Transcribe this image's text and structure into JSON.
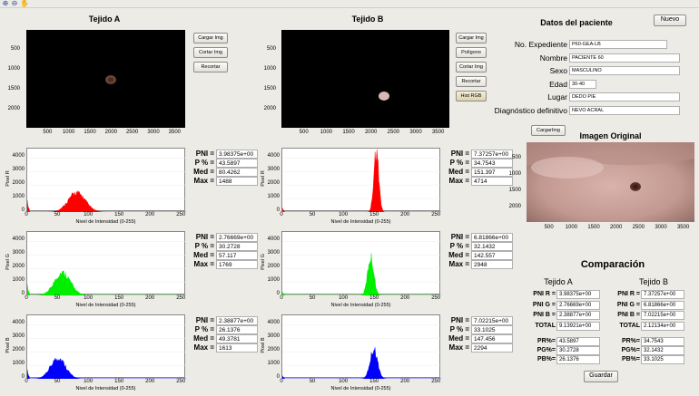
{
  "toolbar": {
    "icons": [
      "zoom-in-icon",
      "zoom-out-icon",
      "pan-icon"
    ]
  },
  "tejido_a": {
    "title": "Tejido A",
    "x_ticks": [
      "500",
      "1000",
      "1500",
      "2000",
      "2500",
      "3000",
      "3500"
    ],
    "y_ticks": [
      "500",
      "1000",
      "1500",
      "2000"
    ],
    "buttons": [
      "Cargar Img",
      "Cortar Img",
      "Recortar"
    ]
  },
  "tejido_b": {
    "title": "Tejido B",
    "x_ticks": [
      "500",
      "1000",
      "1500",
      "2000",
      "2500",
      "3000",
      "3500"
    ],
    "y_ticks": [
      "500",
      "1000",
      "1500",
      "2000"
    ],
    "buttons": [
      "Cargar Img",
      "Polígono",
      "Cortar Img",
      "Recortar",
      "Hist RGB"
    ]
  },
  "histogram_axes": {
    "x_ticks": [
      "0",
      "50",
      "100",
      "150",
      "200",
      "250"
    ],
    "y_ticks": [
      "0",
      "1000",
      "2000",
      "3000",
      "4000"
    ],
    "xlabel": "Nivel de Intensidad (0-255)"
  },
  "stat_labels": {
    "pni": "PNI =",
    "p": "P % =",
    "med": "Med =",
    "max": "Max ="
  },
  "histograms": {
    "a_r": {
      "ylabel": "Pixel R",
      "color": "#ff0000",
      "pni": "3.98375e+00",
      "p": "43.5897",
      "med": "80.4262",
      "max": "1488"
    },
    "a_g": {
      "ylabel": "Pixel G",
      "color": "#00ee00",
      "pni": "2.76669e+00",
      "p": "30.2728",
      "med": "57.117",
      "max": "1769"
    },
    "a_b": {
      "ylabel": "Pixel B",
      "color": "#0000ff",
      "pni": "2.38877e+00",
      "p": "26.1376",
      "med": "49.3781",
      "max": "1613"
    },
    "b_r": {
      "ylabel": "Pixel R",
      "color": "#ff0000",
      "pni": "7.37257e+00",
      "p": "34.7543",
      "med": "151.397",
      "max": "4714"
    },
    "b_g": {
      "ylabel": "Pixel G",
      "color": "#00ee00",
      "pni": "6.81866e+00",
      "p": "32.1432",
      "med": "142.557",
      "max": "2948"
    },
    "b_b": {
      "ylabel": "Pixel B",
      "color": "#0000ff",
      "pni": "7.02215e+00",
      "p": "33.1025",
      "med": "147.456",
      "max": "2294"
    }
  },
  "patient": {
    "title": "Datos del paciente",
    "new_button": "Nuevo",
    "fields": [
      {
        "label": "No. Expediente",
        "value": "P60-GEA-LB"
      },
      {
        "label": "Nombre",
        "value": "PACIENTE 60"
      },
      {
        "label": "Sexo",
        "value": "MASCULINO"
      },
      {
        "label": "Edad",
        "value": "30-40"
      },
      {
        "label": "Lugar",
        "value": "DEDO PIE"
      },
      {
        "label": "Diagnóstico definitivo",
        "value": "NEVO ACRAL"
      }
    ],
    "load_button": "CargarImg"
  },
  "original": {
    "title": "Imagen Original",
    "x_ticks": [
      "500",
      "1000",
      "1500",
      "2000",
      "2500",
      "3000",
      "3500"
    ],
    "y_ticks": [
      "500",
      "1000",
      "1500",
      "2000"
    ]
  },
  "comparison": {
    "title": "Comparación",
    "col_a": "Tejido A",
    "col_b": "Tejido B",
    "labels": [
      "PNI R =",
      "PNI G =",
      "PNI B =",
      "TOTAL"
    ],
    "a_values": [
      "3.98375e+00",
      "2.76669e+00",
      "2.38877e+00",
      "9.13921e+00"
    ],
    "b_values": [
      "7.37257e+00",
      "6.81866e+00",
      "7.02215e+00",
      "2.12134e+00"
    ],
    "pr_labels": [
      "PR%=",
      "PG%=",
      "PB%="
    ],
    "a_pr": [
      "43.5897",
      "30.2728",
      "26.1376"
    ],
    "b_pr": [
      "34.7543",
      "32.1432",
      "33.1025"
    ],
    "save_button": "Guardar"
  }
}
